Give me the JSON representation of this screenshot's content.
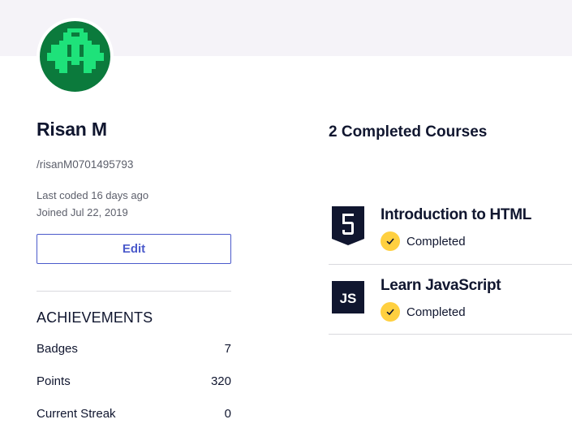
{
  "profile": {
    "name": "Risan M",
    "handle": "/risanM0701495793",
    "last_coded": "Last coded 16 days ago",
    "joined": "Joined Jul 22, 2019",
    "edit_label": "Edit",
    "avatar_icon": "pixel-alien-icon",
    "avatar_colors": {
      "background": "#0b7a3c",
      "pixels": "#1ee27a"
    }
  },
  "achievements": {
    "title": "ACHIEVEMENTS",
    "stats": [
      {
        "label": "Badges",
        "value": "7"
      },
      {
        "label": "Points",
        "value": "320"
      },
      {
        "label": "Current Streak",
        "value": "0"
      }
    ]
  },
  "courses": {
    "title": "2 Completed Courses",
    "items": [
      {
        "name": "Introduction to HTML",
        "status": "Completed",
        "icon": "html5-icon"
      },
      {
        "name": "Learn JavaScript",
        "status": "Completed",
        "icon": "js-icon"
      }
    ]
  },
  "colors": {
    "accent": "#4b5acb",
    "dark_navy": "#10162f",
    "completed_badge": "#ffd040",
    "header_band": "#f5f3f8"
  }
}
